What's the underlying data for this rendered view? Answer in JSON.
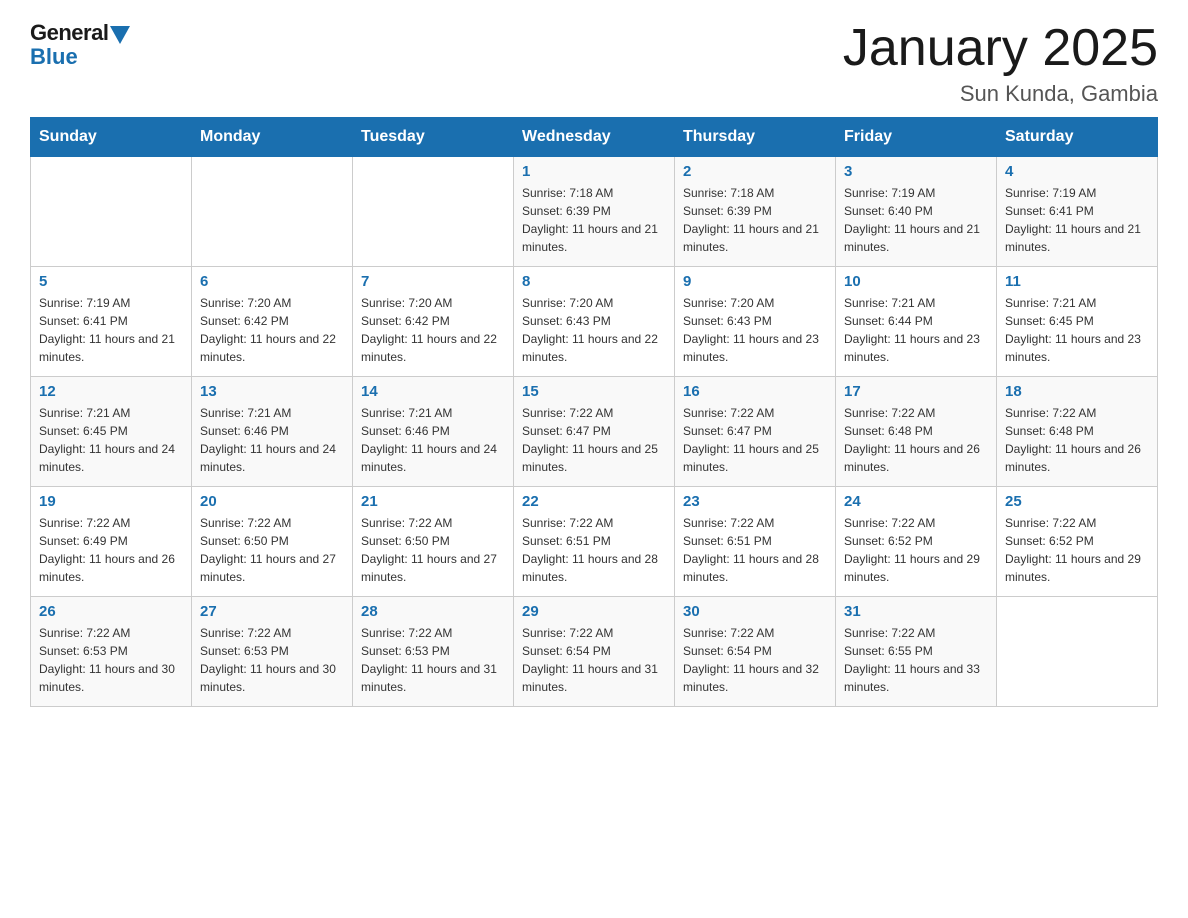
{
  "header": {
    "logo_general": "General",
    "logo_blue": "Blue",
    "title": "January 2025",
    "subtitle": "Sun Kunda, Gambia"
  },
  "days_of_week": [
    "Sunday",
    "Monday",
    "Tuesday",
    "Wednesday",
    "Thursday",
    "Friday",
    "Saturday"
  ],
  "weeks": [
    [
      {
        "day": "",
        "info": ""
      },
      {
        "day": "",
        "info": ""
      },
      {
        "day": "",
        "info": ""
      },
      {
        "day": "1",
        "info": "Sunrise: 7:18 AM\nSunset: 6:39 PM\nDaylight: 11 hours and 21 minutes."
      },
      {
        "day": "2",
        "info": "Sunrise: 7:18 AM\nSunset: 6:39 PM\nDaylight: 11 hours and 21 minutes."
      },
      {
        "day": "3",
        "info": "Sunrise: 7:19 AM\nSunset: 6:40 PM\nDaylight: 11 hours and 21 minutes."
      },
      {
        "day": "4",
        "info": "Sunrise: 7:19 AM\nSunset: 6:41 PM\nDaylight: 11 hours and 21 minutes."
      }
    ],
    [
      {
        "day": "5",
        "info": "Sunrise: 7:19 AM\nSunset: 6:41 PM\nDaylight: 11 hours and 21 minutes."
      },
      {
        "day": "6",
        "info": "Sunrise: 7:20 AM\nSunset: 6:42 PM\nDaylight: 11 hours and 22 minutes."
      },
      {
        "day": "7",
        "info": "Sunrise: 7:20 AM\nSunset: 6:42 PM\nDaylight: 11 hours and 22 minutes."
      },
      {
        "day": "8",
        "info": "Sunrise: 7:20 AM\nSunset: 6:43 PM\nDaylight: 11 hours and 22 minutes."
      },
      {
        "day": "9",
        "info": "Sunrise: 7:20 AM\nSunset: 6:43 PM\nDaylight: 11 hours and 23 minutes."
      },
      {
        "day": "10",
        "info": "Sunrise: 7:21 AM\nSunset: 6:44 PM\nDaylight: 11 hours and 23 minutes."
      },
      {
        "day": "11",
        "info": "Sunrise: 7:21 AM\nSunset: 6:45 PM\nDaylight: 11 hours and 23 minutes."
      }
    ],
    [
      {
        "day": "12",
        "info": "Sunrise: 7:21 AM\nSunset: 6:45 PM\nDaylight: 11 hours and 24 minutes."
      },
      {
        "day": "13",
        "info": "Sunrise: 7:21 AM\nSunset: 6:46 PM\nDaylight: 11 hours and 24 minutes."
      },
      {
        "day": "14",
        "info": "Sunrise: 7:21 AM\nSunset: 6:46 PM\nDaylight: 11 hours and 24 minutes."
      },
      {
        "day": "15",
        "info": "Sunrise: 7:22 AM\nSunset: 6:47 PM\nDaylight: 11 hours and 25 minutes."
      },
      {
        "day": "16",
        "info": "Sunrise: 7:22 AM\nSunset: 6:47 PM\nDaylight: 11 hours and 25 minutes."
      },
      {
        "day": "17",
        "info": "Sunrise: 7:22 AM\nSunset: 6:48 PM\nDaylight: 11 hours and 26 minutes."
      },
      {
        "day": "18",
        "info": "Sunrise: 7:22 AM\nSunset: 6:48 PM\nDaylight: 11 hours and 26 minutes."
      }
    ],
    [
      {
        "day": "19",
        "info": "Sunrise: 7:22 AM\nSunset: 6:49 PM\nDaylight: 11 hours and 26 minutes."
      },
      {
        "day": "20",
        "info": "Sunrise: 7:22 AM\nSunset: 6:50 PM\nDaylight: 11 hours and 27 minutes."
      },
      {
        "day": "21",
        "info": "Sunrise: 7:22 AM\nSunset: 6:50 PM\nDaylight: 11 hours and 27 minutes."
      },
      {
        "day": "22",
        "info": "Sunrise: 7:22 AM\nSunset: 6:51 PM\nDaylight: 11 hours and 28 minutes."
      },
      {
        "day": "23",
        "info": "Sunrise: 7:22 AM\nSunset: 6:51 PM\nDaylight: 11 hours and 28 minutes."
      },
      {
        "day": "24",
        "info": "Sunrise: 7:22 AM\nSunset: 6:52 PM\nDaylight: 11 hours and 29 minutes."
      },
      {
        "day": "25",
        "info": "Sunrise: 7:22 AM\nSunset: 6:52 PM\nDaylight: 11 hours and 29 minutes."
      }
    ],
    [
      {
        "day": "26",
        "info": "Sunrise: 7:22 AM\nSunset: 6:53 PM\nDaylight: 11 hours and 30 minutes."
      },
      {
        "day": "27",
        "info": "Sunrise: 7:22 AM\nSunset: 6:53 PM\nDaylight: 11 hours and 30 minutes."
      },
      {
        "day": "28",
        "info": "Sunrise: 7:22 AM\nSunset: 6:53 PM\nDaylight: 11 hours and 31 minutes."
      },
      {
        "day": "29",
        "info": "Sunrise: 7:22 AM\nSunset: 6:54 PM\nDaylight: 11 hours and 31 minutes."
      },
      {
        "day": "30",
        "info": "Sunrise: 7:22 AM\nSunset: 6:54 PM\nDaylight: 11 hours and 32 minutes."
      },
      {
        "day": "31",
        "info": "Sunrise: 7:22 AM\nSunset: 6:55 PM\nDaylight: 11 hours and 33 minutes."
      },
      {
        "day": "",
        "info": ""
      }
    ]
  ]
}
